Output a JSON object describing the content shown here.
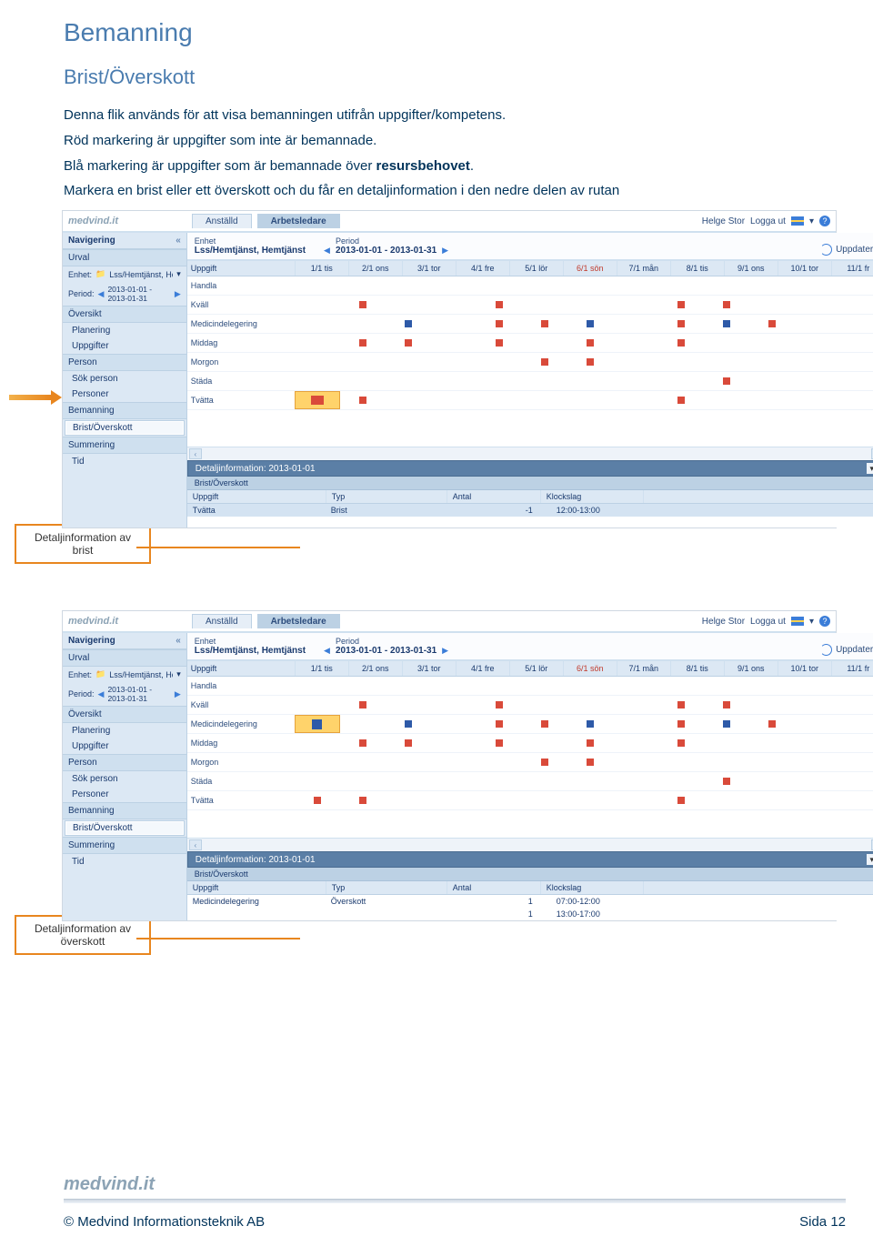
{
  "doc": {
    "h1": "Bemanning",
    "h2": "Brist/Överskott",
    "p1": "Denna flik används för att visa bemanningen utifrån uppgifter/kompetens.",
    "p2": "Röd markering är uppgifter som inte är bemannade.",
    "p3a": "Blå markering är uppgifter som är bemannade över ",
    "p3b": "resursbehovet",
    "p3c": ".",
    "p4": "Markera en brist eller ett överskott och du får en detaljinformation i den nedre delen av rutan"
  },
  "callouts": {
    "brist_l1": "Detaljinformation av",
    "brist_l2": "brist",
    "over_l1": "Detaljinformation av",
    "over_l2": "överskott"
  },
  "app": {
    "logo": "medvind.it",
    "tabs": {
      "anstalld": "Anställd",
      "arbetsledare": "Arbetsledare"
    },
    "user": "Helge Stor",
    "logout": "Logga ut",
    "nav_title": "Navigering",
    "urval": "Urval",
    "enhet_lbl": "Enhet:",
    "enhet_val": "Lss/Hemtjänst, Hemtjänst",
    "period_lbl": "Period:",
    "period_val": "2013-01-01 - 2013-01-31",
    "sections": {
      "oversikt": "Översikt",
      "person": "Person",
      "bemanning": "Bemanning",
      "summering": "Summering"
    },
    "items": {
      "planering": "Planering",
      "uppgifter": "Uppgifter",
      "sokperson": "Sök person",
      "personer": "Personer",
      "bristoverskott": "Brist/Överskott",
      "tid": "Tid"
    },
    "main": {
      "enhet_lbl": "Enhet",
      "enhet_val": "Lss/Hemtjänst, Hemtjänst",
      "period_lbl": "Period",
      "period_val": "2013-01-01 - 2013-01-31",
      "uppdatera": "Uppdatera"
    },
    "grid": {
      "col_task": "Uppgift",
      "days": [
        "1/1 tis",
        "2/1 ons",
        "3/1 tor",
        "4/1 fre",
        "5/1 lör",
        "6/1 sön",
        "7/1 mån",
        "8/1 tis",
        "9/1 ons",
        "10/1 tor",
        "11/1 fr"
      ],
      "rows": [
        "Handla",
        "Kväll",
        "Medicindelegering",
        "Middag",
        "Morgon",
        "Städa",
        "Tvätta"
      ]
    },
    "detail": {
      "title": "Detaljinformation: 2013-01-01",
      "subtitle": "Brist/Överskott",
      "cols": {
        "uppgift": "Uppgift",
        "typ": "Typ",
        "antal": "Antal",
        "klockslag": "Klockslag"
      }
    },
    "detail1_rows": [
      {
        "u": "Tvätta",
        "t": "Brist",
        "a": "-1",
        "k": "12:00-13:00"
      }
    ],
    "detail2_rows": [
      {
        "u": "Medicindelegering",
        "t": "Överskott",
        "a": "1",
        "k": "07:00-12:00"
      },
      {
        "u": "",
        "t": "",
        "a": "1",
        "k": "13:00-17:00"
      }
    ]
  },
  "footer": {
    "brand": "medvind.it",
    "copyright": "© Medvind Informationsteknik AB",
    "page": "Sida 12"
  }
}
